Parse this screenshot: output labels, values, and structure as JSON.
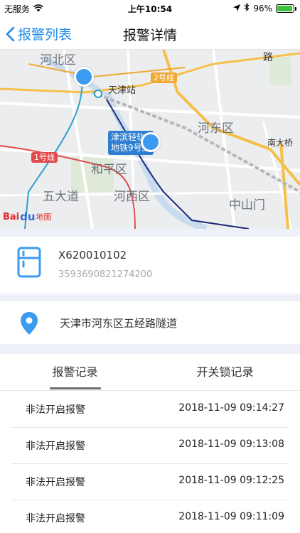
{
  "status_bar": {
    "carrier": "无服务",
    "time": "上午10:54",
    "battery_text": "96%",
    "battery_level": 0.96
  },
  "nav": {
    "back_label": "报警列表",
    "title": "报警详情"
  },
  "map": {
    "labels": {
      "hebei": "河北区",
      "tianjin_station": "天津站",
      "hedong": "河东区",
      "heping": "和平区",
      "wudadao": "五大道",
      "hexi": "河西区",
      "zhongshanmen": "中山门",
      "nandaqiao": "南大桥",
      "lu": "路"
    },
    "metro_badges": {
      "line1": "1号线",
      "line2": "2号线"
    },
    "metro_tag_line1": "津滨轻轨",
    "metro_tag_line2": "地铁9号线",
    "logo_bai": "Bai",
    "logo_paw": "du",
    "logo_ditu": "地图"
  },
  "device": {
    "id": "X620010102",
    "imei": "3593690821274200"
  },
  "address": "天津市河东区五经路隧道",
  "tabs": {
    "alarm_records": "报警记录",
    "lock_records": "开关锁记录"
  },
  "records": [
    {
      "type": "非法开启报警",
      "time": "2018-11-09 09:14:27"
    },
    {
      "type": "非法开启报警",
      "time": "2018-11-09 09:13:08"
    },
    {
      "type": "非法开启报警",
      "time": "2018-11-09 09:12:25"
    },
    {
      "type": "非法开启报警",
      "time": "2018-11-09 09:11:09"
    }
  ],
  "colors": {
    "accent": "#1e88e5",
    "marker": "#3a9bf0",
    "separator": "#eef1f8"
  }
}
